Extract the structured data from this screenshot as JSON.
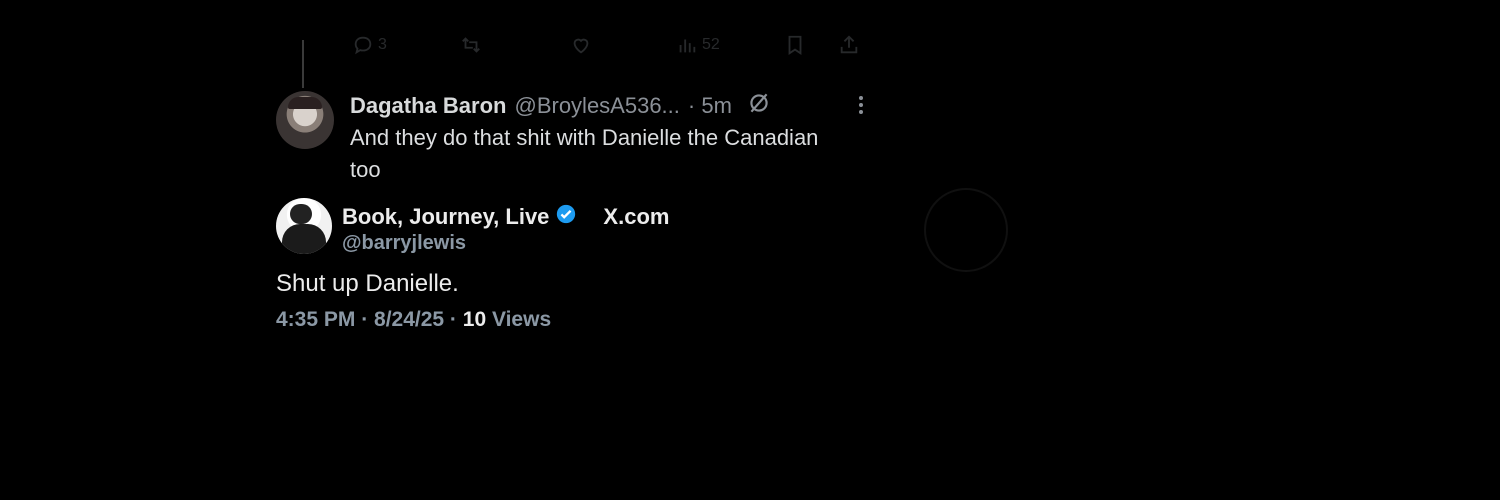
{
  "reply_bar": {
    "reply_count": "3",
    "views_count": "52"
  },
  "reply_tweet": {
    "name": "Dagatha Baron",
    "handle": "@BroylesA536...",
    "time": "· 5m",
    "text": "And they do that shit with Danielle the Canadian too"
  },
  "quote": {
    "name": "Book, Journey, Live",
    "brand": "X.com",
    "handle": "@barryjlewis",
    "text": "Shut up Danielle.",
    "meta_prefix": "4:35 PM · 8/24/25 · ",
    "views_count": "10",
    "views_label": "Views"
  },
  "colors": {
    "background": "#000000",
    "verified": "#1d9bf0",
    "muted": "#8b98a5"
  }
}
